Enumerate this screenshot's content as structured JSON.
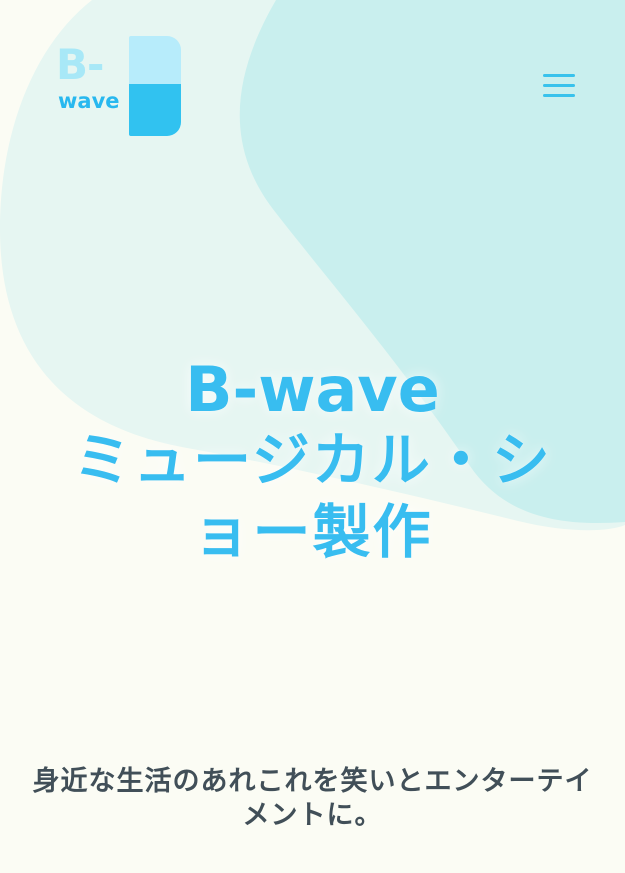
{
  "brand": {
    "logo_top": "B-",
    "logo_bottom": "wave"
  },
  "header": {
    "menu_icon": "hamburger-menu-icon"
  },
  "hero": {
    "title_line_1": "B-wave",
    "title_line_2": "ミュージカル・シ",
    "title_line_3": "ョー製作",
    "tagline": "身近な生活のあれこれを笑いとエンターテイメントに。"
  },
  "colors": {
    "background": "#fbfcf4",
    "accent": "#38bdf0",
    "light_accent": "#a8e8f7",
    "blob_light": "#e6f6f2",
    "blob_main": "#c9efee",
    "text_dark": "#414f58"
  }
}
